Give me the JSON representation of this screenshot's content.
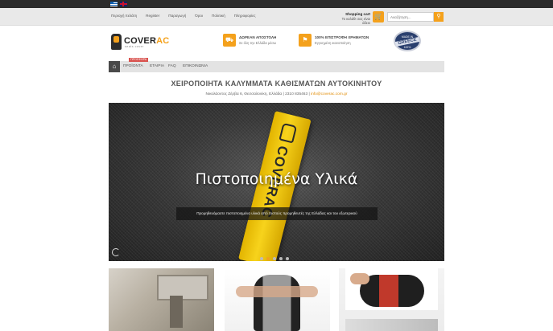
{
  "languages": [
    "Greek",
    "English"
  ],
  "topbar": {
    "links": [
      "Περιοχή πελάτη",
      "Register",
      "Παραγωγή",
      "Όροι",
      "Πολιτική",
      "Πληροφορίες"
    ],
    "cart_title": "Shopping cart",
    "cart_status": "Το καλάθι σας είναι άδειο",
    "search_placeholder": "Αναζήτηση...",
    "accent": "#f4a11c"
  },
  "header": {
    "logo_main": "COVER",
    "logo_accent": "AC",
    "logo_tagline": "seats cover",
    "features": [
      {
        "icon": "truck-icon",
        "title": "ΔΩΡΕΑΝ ΑΠΟΣΤΟΛΗ",
        "subtitle": "Σε όλη την Ελλάδα μέσω"
      },
      {
        "icon": "money-back-icon",
        "title": "100% ΕΠΙΣΤΡΟΦΗ ΧΡΗΜΑΤΩΝ",
        "subtitle": "Εγγυημένη ικανοποίηση"
      }
    ],
    "badge": {
      "top": "MADE IN",
      "main": "GREECE",
      "bottom": "100%"
    }
  },
  "nav": {
    "items": [
      "ΠΡΟΪΟΝΤΑ",
      "ΕΤΑΙΡΙΑ",
      "FAQ",
      "ΕΠΙΚΟΙΝΩΝΙΑ"
    ],
    "ribbon": "ΠΡΟΣΦΟΡΑ"
  },
  "page": {
    "title": "ΧΕΙΡΟΠΟΙΗΤΑ ΚΑΛΥΜΜΑΤΑ ΚΑΘΙΣΜΑΤΩΝ ΑΥΤΟΚΙΝΗΤΟΥ",
    "address": "Νικολάοντος Ζέρβα 6, Θεσσαλονίκη, Ελλάδα | 2310 835463 | ",
    "email": "info@coverac.com.gr"
  },
  "hero": {
    "title": "Πιστοποιημένα Υλικά",
    "caption": "Προμηθευόμαστε πιστοποιημένα υλικά από πιστούς προμηθευτές της Ελλάδας και του εξωτερικού",
    "tag_print": "COVERAC",
    "slides": 5,
    "active_slide": 1
  }
}
